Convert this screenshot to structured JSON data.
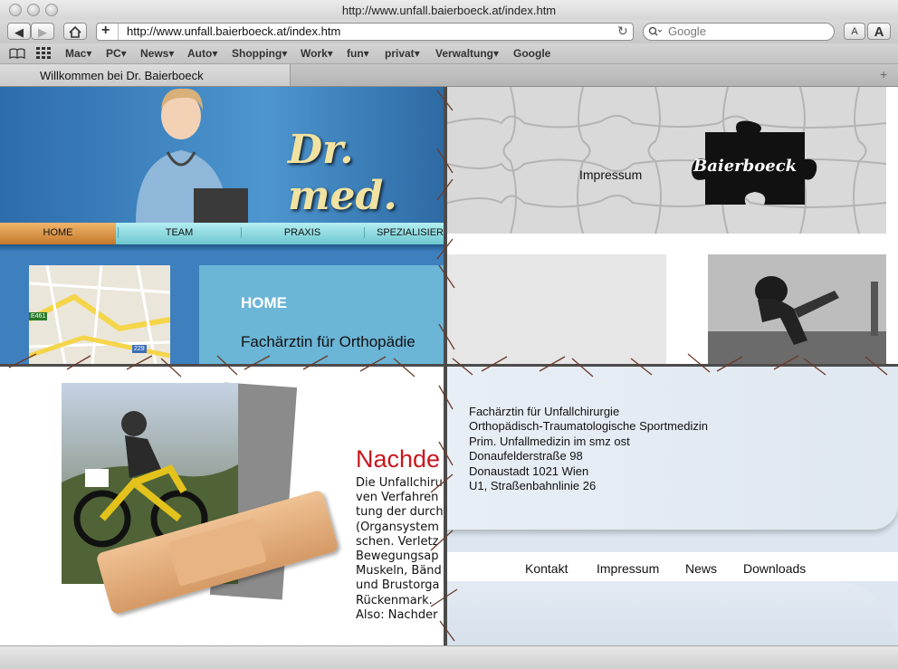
{
  "window": {
    "title": "http://www.unfall.baierboeck.at/index.htm"
  },
  "toolbar": {
    "back_icon": "back-arrow-icon",
    "forward_icon": "forward-arrow-icon",
    "home_icon": "home-icon",
    "add_bookmark": "+",
    "url": "http://www.unfall.baierboeck.at/index.htm",
    "reload_icon": "reload-icon",
    "search_placeholder": "Google",
    "text_smaller": "A",
    "text_larger": "A"
  },
  "bookmarks": [
    "Mac",
    "PC",
    "News",
    "Auto",
    "Shopping",
    "Work",
    "fun",
    "privat",
    "Verwaltung",
    "Google"
  ],
  "tab": {
    "title": "Willkommen bei Dr. Baierboeck"
  },
  "header": {
    "logo_text": "Dr. med."
  },
  "nav": [
    "HOME",
    "TEAM",
    "PRAXIS",
    "SPEZIALISIER"
  ],
  "map": {
    "road_label_1": "E461",
    "road_label_2": "229"
  },
  "content": {
    "heading": "HOME",
    "subtitle": "Fachärztin für Orthopädie"
  },
  "puzzle": {
    "impressum": "Impressum",
    "brand": "Baierboeck"
  },
  "article": {
    "heading": "Nachde",
    "lines": [
      "Die Unfallchiru",
      "ven Verfahren",
      "tung der durch",
      "(Organsystem",
      "schen. Verletz",
      "Bewegungsap",
      "Muskeln, Bänd",
      "und Brustorga",
      "Rückenmark.",
      "Also: Nachder"
    ]
  },
  "address": {
    "lines": [
      "Fachärztin für Unfallchirurgie",
      "Orthopädisch-Traumatologische Sportmedizin",
      "Prim.  Unfallmedizin im smz ost",
      "Donaufelderstraße 98",
      "Donaustadt 1021 Wien",
      "U1, Straßenbahnlinie 26"
    ]
  },
  "footer_links": [
    "Kontakt",
    "Impressum",
    "News",
    "Downloads"
  ],
  "colors": {
    "nav_active": "#d98f3a",
    "nav_bar": "#7fcfd6",
    "article_heading": "#c8171e",
    "header_blue": "#3e7fbd"
  }
}
